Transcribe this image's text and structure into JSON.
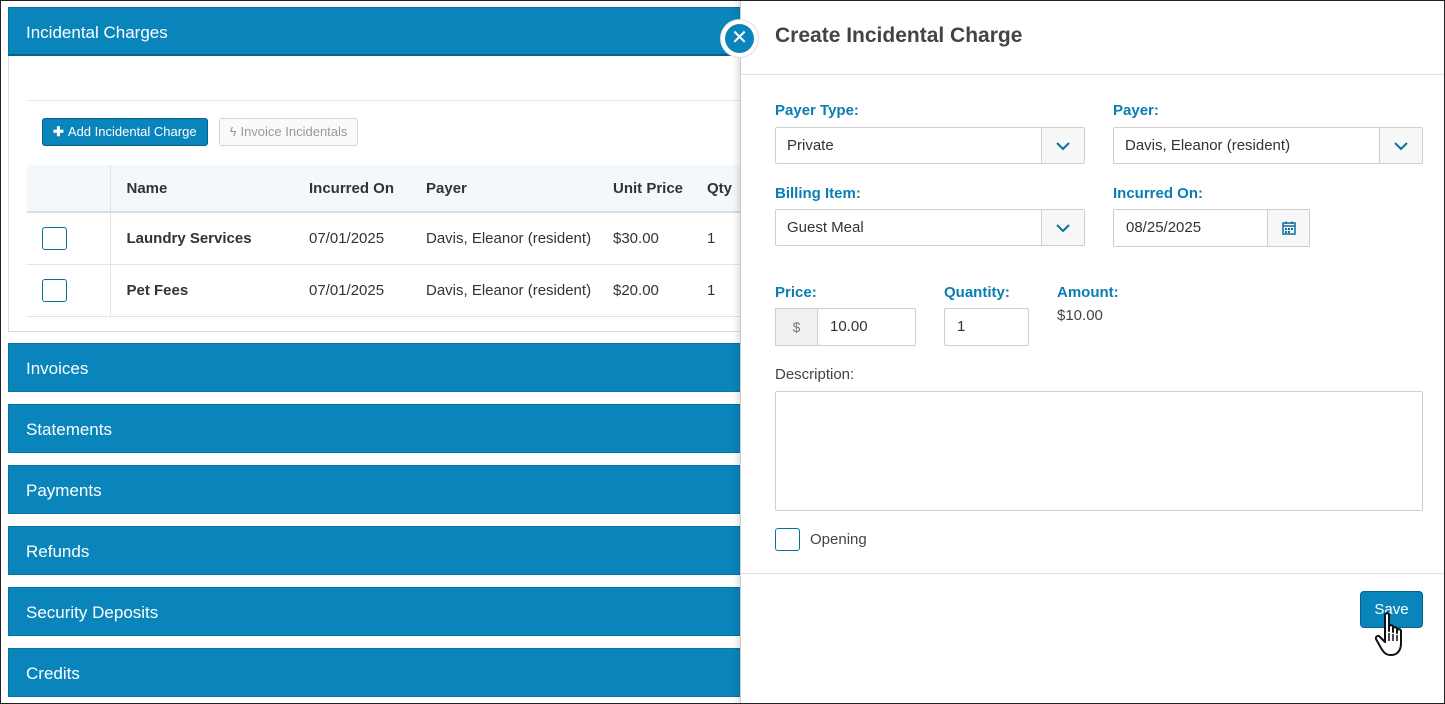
{
  "accordion": {
    "incidental": {
      "title": "Incidental Charges"
    },
    "toolbar": {
      "add_label": "Add Incidental Charge",
      "invoice_label": "Invoice Incidentals"
    },
    "table": {
      "headers": {
        "name": "Name",
        "incurred_on": "Incurred On",
        "payer": "Payer",
        "unit_price": "Unit Price",
        "qty": "Qty"
      },
      "rows": [
        {
          "name": "Laundry Services",
          "incurred_on": "07/01/2025",
          "payer": "Davis, Eleanor (resident)",
          "unit_price": "$30.00",
          "qty": "1"
        },
        {
          "name": "Pet Fees",
          "incurred_on": "07/01/2025",
          "payer": "Davis, Eleanor (resident)",
          "unit_price": "$20.00",
          "qty": "1"
        }
      ]
    },
    "sections": [
      "Invoices",
      "Statements",
      "Payments",
      "Refunds",
      "Security Deposits",
      "Credits"
    ]
  },
  "panel": {
    "title": "Create Incidental Charge",
    "payer_type": {
      "label": "Payer Type:",
      "value": "Private"
    },
    "payer": {
      "label": "Payer:",
      "value": "Davis, Eleanor (resident)"
    },
    "billing_item": {
      "label": "Billing Item:",
      "value": "Guest Meal"
    },
    "incurred_on": {
      "label": "Incurred On:",
      "value": "08/25/2025"
    },
    "price": {
      "label": "Price:",
      "currency": "$",
      "value": "10.00"
    },
    "quantity": {
      "label": "Quantity:",
      "value": "1"
    },
    "amount": {
      "label": "Amount:",
      "value": "$10.00"
    },
    "description": {
      "label": "Description:",
      "value": ""
    },
    "opening": {
      "label": "Opening"
    },
    "save_label": "Save"
  },
  "icons": {
    "close": "close-circle-icon",
    "plus": "plus-icon",
    "bolt": "lightning-icon",
    "chevron": "chevron-down-icon",
    "calendar": "calendar-icon",
    "cursor": "hand-pointer-icon"
  },
  "colors": {
    "accent": "#0a85bb",
    "label": "#0a7db2"
  }
}
